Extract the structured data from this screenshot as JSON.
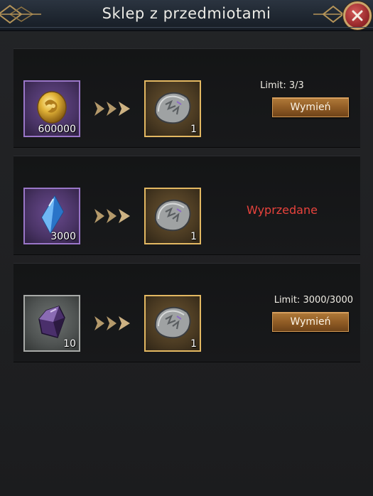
{
  "header": {
    "title": "Sklep z przedmiotami"
  },
  "colors": {
    "accent_gold": "#e3b862",
    "button_bronze": "#8e5a24",
    "sold_out_red": "#e8433c",
    "rarity_purple": "#9a76c8",
    "rarity_grey": "#a8aaa8"
  },
  "offers": [
    {
      "input": {
        "icon": "gold-coin-icon",
        "quantity": "600000",
        "rarity": "purple"
      },
      "output": {
        "icon": "rune-stone-icon",
        "quantity": "1"
      },
      "limit": "Limit: 3/3",
      "button": "Wymień"
    },
    {
      "input": {
        "icon": "blue-crystal-icon",
        "quantity": "3000",
        "rarity": "purple"
      },
      "output": {
        "icon": "rune-stone-icon",
        "quantity": "1"
      },
      "status": "Wyprzedane"
    },
    {
      "input": {
        "icon": "dark-shard-icon",
        "quantity": "10",
        "rarity": "grey"
      },
      "output": {
        "icon": "rune-stone-icon",
        "quantity": "1"
      },
      "limit": "Limit: 3000/3000",
      "button": "Wymień"
    }
  ]
}
